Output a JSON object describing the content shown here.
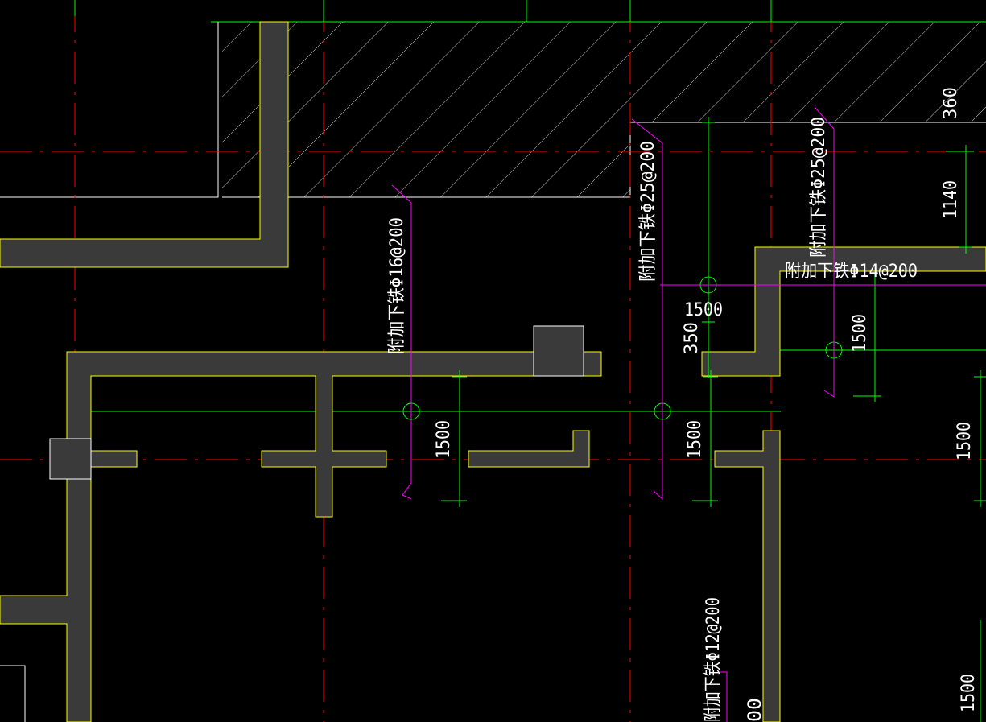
{
  "colors": {
    "background": "#000000",
    "axis": "#ff0000",
    "dimension": "#00ff00",
    "wall_outline": "#ffff00",
    "wall_fill": "#3a3a3a",
    "rebar": "#ff00ff",
    "slab": "#ffffff",
    "text": "#ffffff"
  },
  "labels": {
    "rebar_16": "附加下铁Φ16@200",
    "rebar_25_a": "附加下铁Φ25@200",
    "rebar_25_b": "附加下铁Φ25@200",
    "rebar_14": "附加下铁Φ14@200",
    "rebar_12": "附加下铁Φ12@200",
    "rebar_bottom_partial": "00"
  },
  "dimensions": {
    "d360": "360",
    "d1140": "1140",
    "d1500_horiz": "1500",
    "d350": "350",
    "d1500_a": "1500",
    "d1500_b": "1500",
    "d1500_c": "1500",
    "d1500_d": "1500",
    "d1500_e": "1500"
  }
}
